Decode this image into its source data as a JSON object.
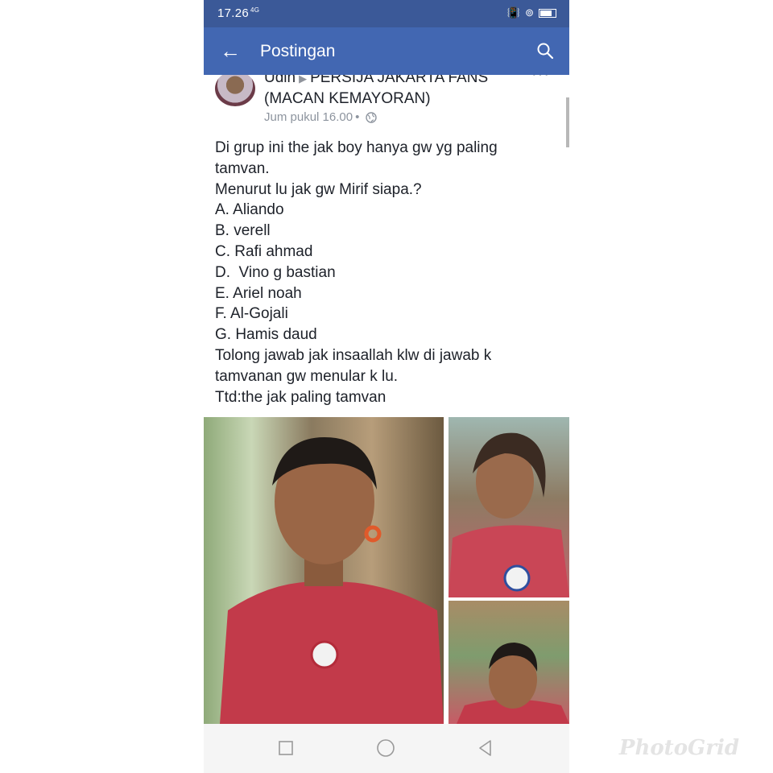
{
  "status_bar": {
    "time": "17.26",
    "network": "4G"
  },
  "app_bar": {
    "title": "Postingan",
    "back_icon": "arrow-left-icon",
    "search_icon": "search-icon"
  },
  "post": {
    "author": "Udin",
    "group": "PERSIJA JAKARTA FANS (MACAN KEMAYORAN)",
    "time": "Jum pukul 16.00",
    "separator": "•",
    "privacy_icon": "globe-icon",
    "body_lines": [
      "Di grup ini the jak boy hanya gw yg paling",
      "tamvan.",
      "Menurut lu jak gw Mirif siapa.?",
      "A. Aliando",
      "B. verell",
      "C. Rafi ahmad",
      "D.  Vino g bastian",
      "E. Ariel noah",
      "F. Al-Gojali",
      "G. Hamis daud",
      "Tolong jawab jak insaallah klw di jawab k",
      "tamvanan gw menular k lu.",
      "Ttd:the jak paling tamvan"
    ]
  },
  "nav_bar": {
    "recents_icon": "square-icon",
    "home_icon": "circle-icon",
    "back_icon": "triangle-back-icon"
  },
  "watermark": "PhotoGrid",
  "colors": {
    "status_bar": "#3b5998",
    "app_bar": "#4267b2",
    "text": "#1d2129",
    "meta_text": "#8d949e"
  }
}
